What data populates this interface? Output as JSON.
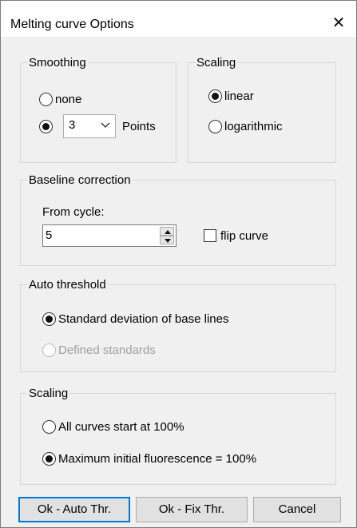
{
  "window": {
    "title": "Melting curve Options",
    "close_glyph": "✕"
  },
  "smoothing": {
    "legend": "Smoothing",
    "none_label": "none",
    "points_value": "3",
    "points_label": "Points",
    "selected": "points"
  },
  "scaling_top": {
    "legend": "Scaling",
    "linear_label": "linear",
    "logarithmic_label": "logarithmic",
    "selected": "linear"
  },
  "baseline": {
    "legend": "Baseline correction",
    "from_cycle_label": "From cycle:",
    "from_cycle_value": "5",
    "flip_label": "flip curve",
    "flip_checked": false
  },
  "auto_threshold": {
    "legend": "Auto threshold",
    "std_dev_label": "Standard deviation of base lines",
    "defined_label": "Defined standards",
    "selected": "std_dev",
    "defined_disabled": true
  },
  "scaling_bottom": {
    "legend": "Scaling",
    "all_start_label": "All curves start at 100%",
    "max_initial_label": "Maximum initial fluorescence = 100%",
    "selected": "max_initial"
  },
  "buttons": {
    "ok_auto": "Ok - Auto Thr.",
    "ok_fix": "Ok - Fix Thr.",
    "cancel": "Cancel"
  },
  "icons": {
    "close": "close-icon",
    "dropdown": "chevron-down-icon",
    "spin_up": "triangle-up-icon",
    "spin_down": "triangle-down-icon"
  }
}
